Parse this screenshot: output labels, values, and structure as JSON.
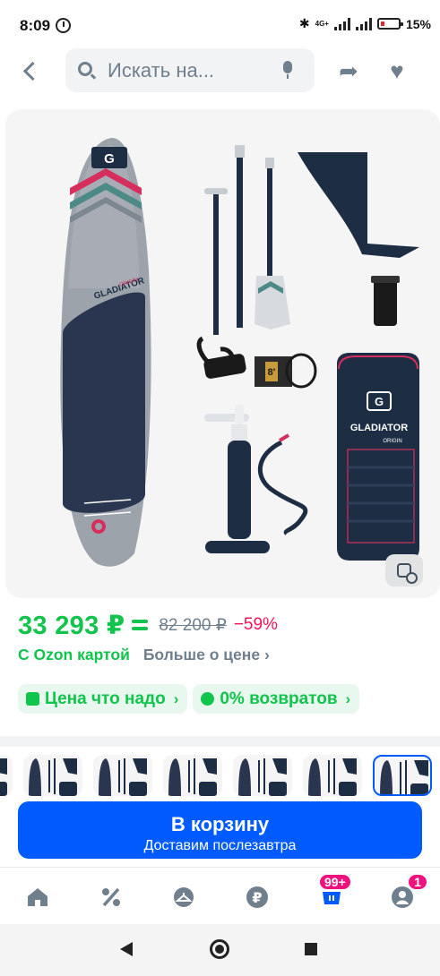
{
  "status_bar": {
    "time": "8:09",
    "network": "4G+",
    "battery_pct": "15%",
    "battery_level": 0.15
  },
  "top_bar": {
    "search_placeholder": "Искать на...",
    "icons": [
      "back-arrow-icon",
      "search-icon",
      "microphone-icon",
      "share-icon",
      "heart-icon"
    ]
  },
  "product_image": {
    "board_brand": "GLADIATOR",
    "board_series": "ORIGIN",
    "bag_brand": "GLADIATOR",
    "bag_series": "ORIGIN",
    "paddle_size": "8'",
    "colors": {
      "board": "#9da3ab",
      "board_deck": "#2a3550",
      "accent": "#d62f5e",
      "navy": "#1d2d44"
    }
  },
  "price": {
    "current": "33 293 ₽",
    "old": "82 200 ₽",
    "discount": "−59%",
    "card_label": "С Ozon картой",
    "more_label": "Больше о цене ›"
  },
  "chips": [
    {
      "label": "Цена что надо",
      "icon": "thumbs-up-icon"
    },
    {
      "label": "0% возвратов",
      "icon": "return-icon"
    }
  ],
  "thumbnails_count": 7,
  "cart": {
    "title": "В корзину",
    "subtitle": "Доставим послезавтра"
  },
  "bottom_nav": {
    "items": [
      "home-icon",
      "discount-icon",
      "catalog-hanger-icon",
      "ruble-icon",
      "cart-icon",
      "profile-icon"
    ],
    "cart_badge": "99+",
    "profile_badge": "1"
  },
  "colors": {
    "brand_blue": "#005bff",
    "price_green": "#10c44c",
    "discount_red": "#f91155",
    "badge_pink": "#f1117e",
    "muted": "#707f8d"
  }
}
